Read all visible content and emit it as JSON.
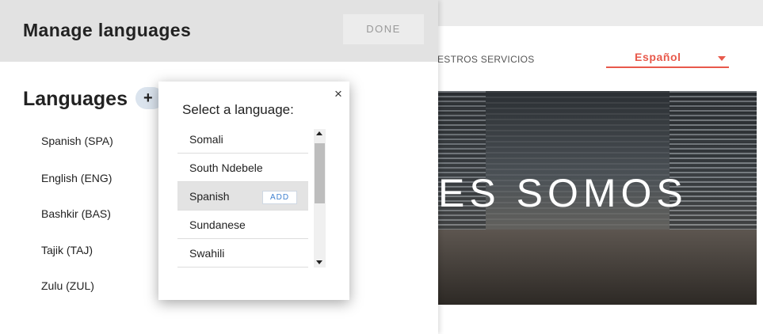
{
  "site": {
    "nav_text": "ESTROS SERVICIOS",
    "language_select": {
      "value": "Español",
      "accent": "#e8594b"
    },
    "hero_title": "ES SOMOS"
  },
  "panel": {
    "title": "Manage languages",
    "done_label": "DONE",
    "section_title": "Languages",
    "add_symbol": "+",
    "languages": [
      "Spanish (SPA)",
      "English (ENG)",
      "Bashkir (BAS)",
      "Tajik (TAJ)",
      "Zulu (ZUL)"
    ]
  },
  "popup": {
    "title": "Select a language:",
    "close_symbol": "×",
    "options": [
      {
        "label": "Somali"
      },
      {
        "label": "South Ndebele"
      },
      {
        "label": "Spanish",
        "selected": true,
        "action": "ADD"
      },
      {
        "label": "Sundanese"
      },
      {
        "label": "Swahili"
      }
    ]
  }
}
